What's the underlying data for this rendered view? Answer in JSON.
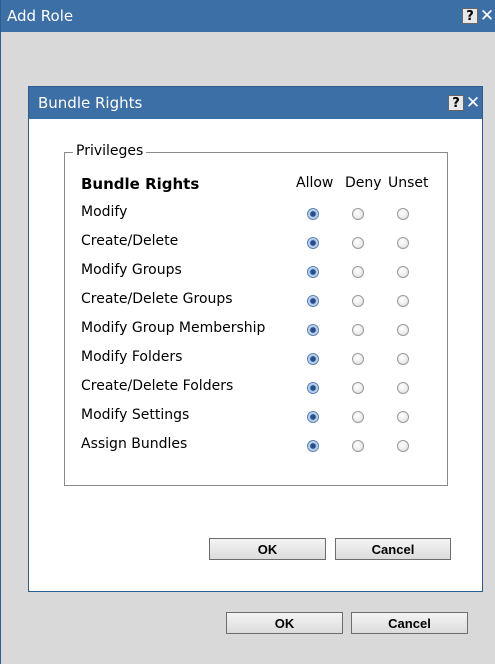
{
  "outer": {
    "title": "Add Role",
    "help": "?",
    "close": "✕",
    "ok_label": "OK",
    "cancel_label": "Cancel"
  },
  "dialog": {
    "title": "Bundle Rights",
    "help": "?",
    "close": "✕",
    "group_label": "Privileges",
    "header": "Bundle Rights",
    "columns": [
      "Allow",
      "Deny",
      "Unset"
    ],
    "rows": [
      {
        "label": "Modify",
        "selected": "Allow"
      },
      {
        "label": "Create/Delete",
        "selected": "Allow"
      },
      {
        "label": "Modify Groups",
        "selected": "Allow"
      },
      {
        "label": "Create/Delete Groups",
        "selected": "Allow"
      },
      {
        "label": "Modify Group Membership",
        "selected": "Allow"
      },
      {
        "label": "Modify Folders",
        "selected": "Allow"
      },
      {
        "label": "Create/Delete Folders",
        "selected": "Allow"
      },
      {
        "label": "Modify Settings",
        "selected": "Allow"
      },
      {
        "label": "Assign Bundles",
        "selected": "Allow"
      }
    ],
    "ok_label": "OK",
    "cancel_label": "Cancel"
  },
  "colors": {
    "titlebar": "#3b6fa6",
    "window_bg": "#d9d9d9",
    "dialog_bg": "#ffffff"
  }
}
